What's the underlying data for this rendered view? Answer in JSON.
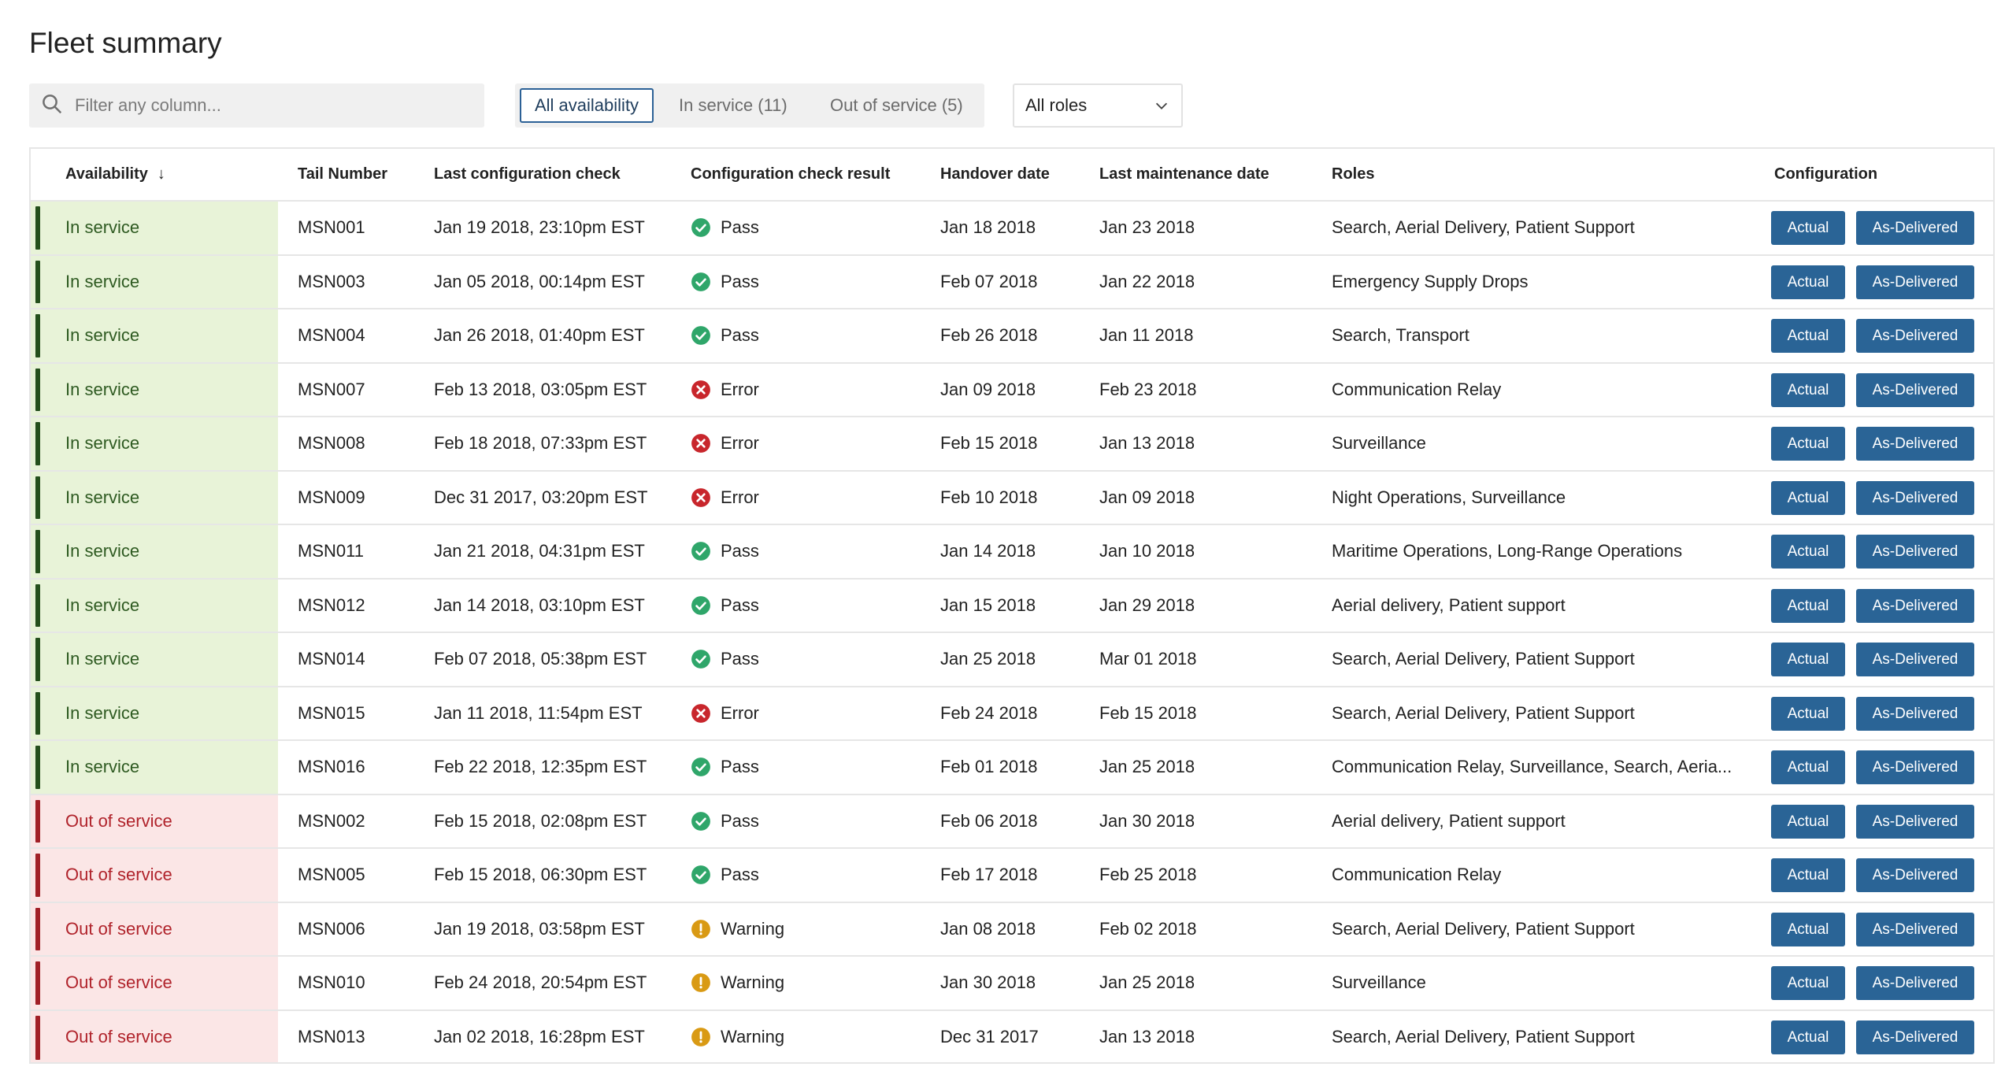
{
  "page": {
    "title": "Fleet summary"
  },
  "search": {
    "placeholder": "Filter any column..."
  },
  "availability_filter": {
    "options": [
      "All availability",
      "In service (11)",
      "Out of service (5)"
    ],
    "selected": "All availability"
  },
  "role_filter": {
    "value": "All roles"
  },
  "table": {
    "headers": {
      "availability": "Availability",
      "sort_arrow": "↓",
      "tail_number": "Tail Number",
      "last_check": "Last configuration check",
      "check_result": "Configuration check result",
      "handover": "Handover date",
      "last_maintenance": "Last maintenance date",
      "roles": "Roles",
      "configuration": "Configuration"
    },
    "button_labels": {
      "actual": "Actual",
      "as_delivered": "As-Delivered"
    },
    "rows": [
      {
        "availability": "In service",
        "tail": "MSN001",
        "check": "Jan 19 2018, 23:10pm EST",
        "result": "Pass",
        "handover": "Jan 18 2018",
        "maintenance": "Jan 23 2018",
        "roles": "Search, Aerial Delivery, Patient Support"
      },
      {
        "availability": "In service",
        "tail": "MSN003",
        "check": "Jan 05 2018, 00:14pm EST",
        "result": "Pass",
        "handover": "Feb 07 2018",
        "maintenance": "Jan 22 2018",
        "roles": "Emergency Supply Drops"
      },
      {
        "availability": "In service",
        "tail": "MSN004",
        "check": "Jan 26 2018, 01:40pm EST",
        "result": "Pass",
        "handover": "Feb 26 2018",
        "maintenance": "Jan 11 2018",
        "roles": "Search, Transport"
      },
      {
        "availability": "In service",
        "tail": "MSN007",
        "check": "Feb 13 2018, 03:05pm EST",
        "result": "Error",
        "handover": "Jan 09 2018",
        "maintenance": "Feb 23 2018",
        "roles": "Communication Relay"
      },
      {
        "availability": "In service",
        "tail": "MSN008",
        "check": "Feb 18 2018, 07:33pm EST",
        "result": "Error",
        "handover": "Feb 15 2018",
        "maintenance": "Jan 13 2018",
        "roles": "Surveillance"
      },
      {
        "availability": "In service",
        "tail": "MSN009",
        "check": "Dec 31 2017, 03:20pm EST",
        "result": "Error",
        "handover": "Feb 10 2018",
        "maintenance": "Jan 09 2018",
        "roles": "Night Operations, Surveillance"
      },
      {
        "availability": "In service",
        "tail": "MSN011",
        "check": "Jan 21 2018, 04:31pm EST",
        "result": "Pass",
        "handover": "Jan 14 2018",
        "maintenance": "Jan 10 2018",
        "roles": "Maritime Operations, Long-Range Operations"
      },
      {
        "availability": "In service",
        "tail": "MSN012",
        "check": "Jan 14 2018, 03:10pm EST",
        "result": "Pass",
        "handover": "Jan 15 2018",
        "maintenance": "Jan 29 2018",
        "roles": "Aerial delivery, Patient support"
      },
      {
        "availability": "In service",
        "tail": "MSN014",
        "check": "Feb 07 2018, 05:38pm EST",
        "result": "Pass",
        "handover": "Jan 25 2018",
        "maintenance": "Mar 01 2018",
        "roles": "Search, Aerial Delivery, Patient Support"
      },
      {
        "availability": "In service",
        "tail": "MSN015",
        "check": "Jan 11 2018, 11:54pm EST",
        "result": "Error",
        "handover": "Feb 24 2018",
        "maintenance": "Feb 15 2018",
        "roles": "Search, Aerial Delivery, Patient Support"
      },
      {
        "availability": "In service",
        "tail": "MSN016",
        "check": "Feb 22 2018, 12:35pm EST",
        "result": "Pass",
        "handover": "Feb 01 2018",
        "maintenance": "Jan 25 2018",
        "roles": "Communication Relay, Surveillance, Search, Aeria..."
      },
      {
        "availability": "Out of service",
        "tail": "MSN002",
        "check": "Feb 15 2018, 02:08pm EST",
        "result": "Pass",
        "handover": "Feb 06 2018",
        "maintenance": "Jan 30 2018",
        "roles": "Aerial delivery, Patient support"
      },
      {
        "availability": "Out of service",
        "tail": "MSN005",
        "check": "Feb 15 2018, 06:30pm EST",
        "result": "Pass",
        "handover": "Feb 17 2018",
        "maintenance": "Feb 25 2018",
        "roles": "Communication Relay"
      },
      {
        "availability": "Out of service",
        "tail": "MSN006",
        "check": "Jan 19 2018, 03:58pm EST",
        "result": "Warning",
        "handover": "Jan 08 2018",
        "maintenance": "Feb 02 2018",
        "roles": "Search, Aerial Delivery, Patient Support"
      },
      {
        "availability": "Out of service",
        "tail": "MSN010",
        "check": "Feb 24 2018, 20:54pm EST",
        "result": "Warning",
        "handover": "Jan 30 2018",
        "maintenance": "Jan 25 2018",
        "roles": "Surveillance"
      },
      {
        "availability": "Out of service",
        "tail": "MSN013",
        "check": "Jan 02 2018, 16:28pm EST",
        "result": "Warning",
        "handover": "Dec 31 2017",
        "maintenance": "Jan 13 2018",
        "roles": "Search, Aerial Delivery, Patient Support"
      }
    ]
  },
  "icons": {
    "search": "search-icon",
    "chevron": "chevron-down-icon",
    "pass": "check-circle-icon",
    "error": "error-circle-icon",
    "warning": "warning-circle-icon"
  },
  "colors": {
    "accent": "#2a6496",
    "in_service_bg": "#e8f3d8",
    "in_service_bar": "#244f1c",
    "out_service_bg": "#fbe6e6",
    "out_service_bar": "#a11f26",
    "pass": "#2fa66a",
    "error": "#c8262c",
    "warning": "#d99a14"
  }
}
